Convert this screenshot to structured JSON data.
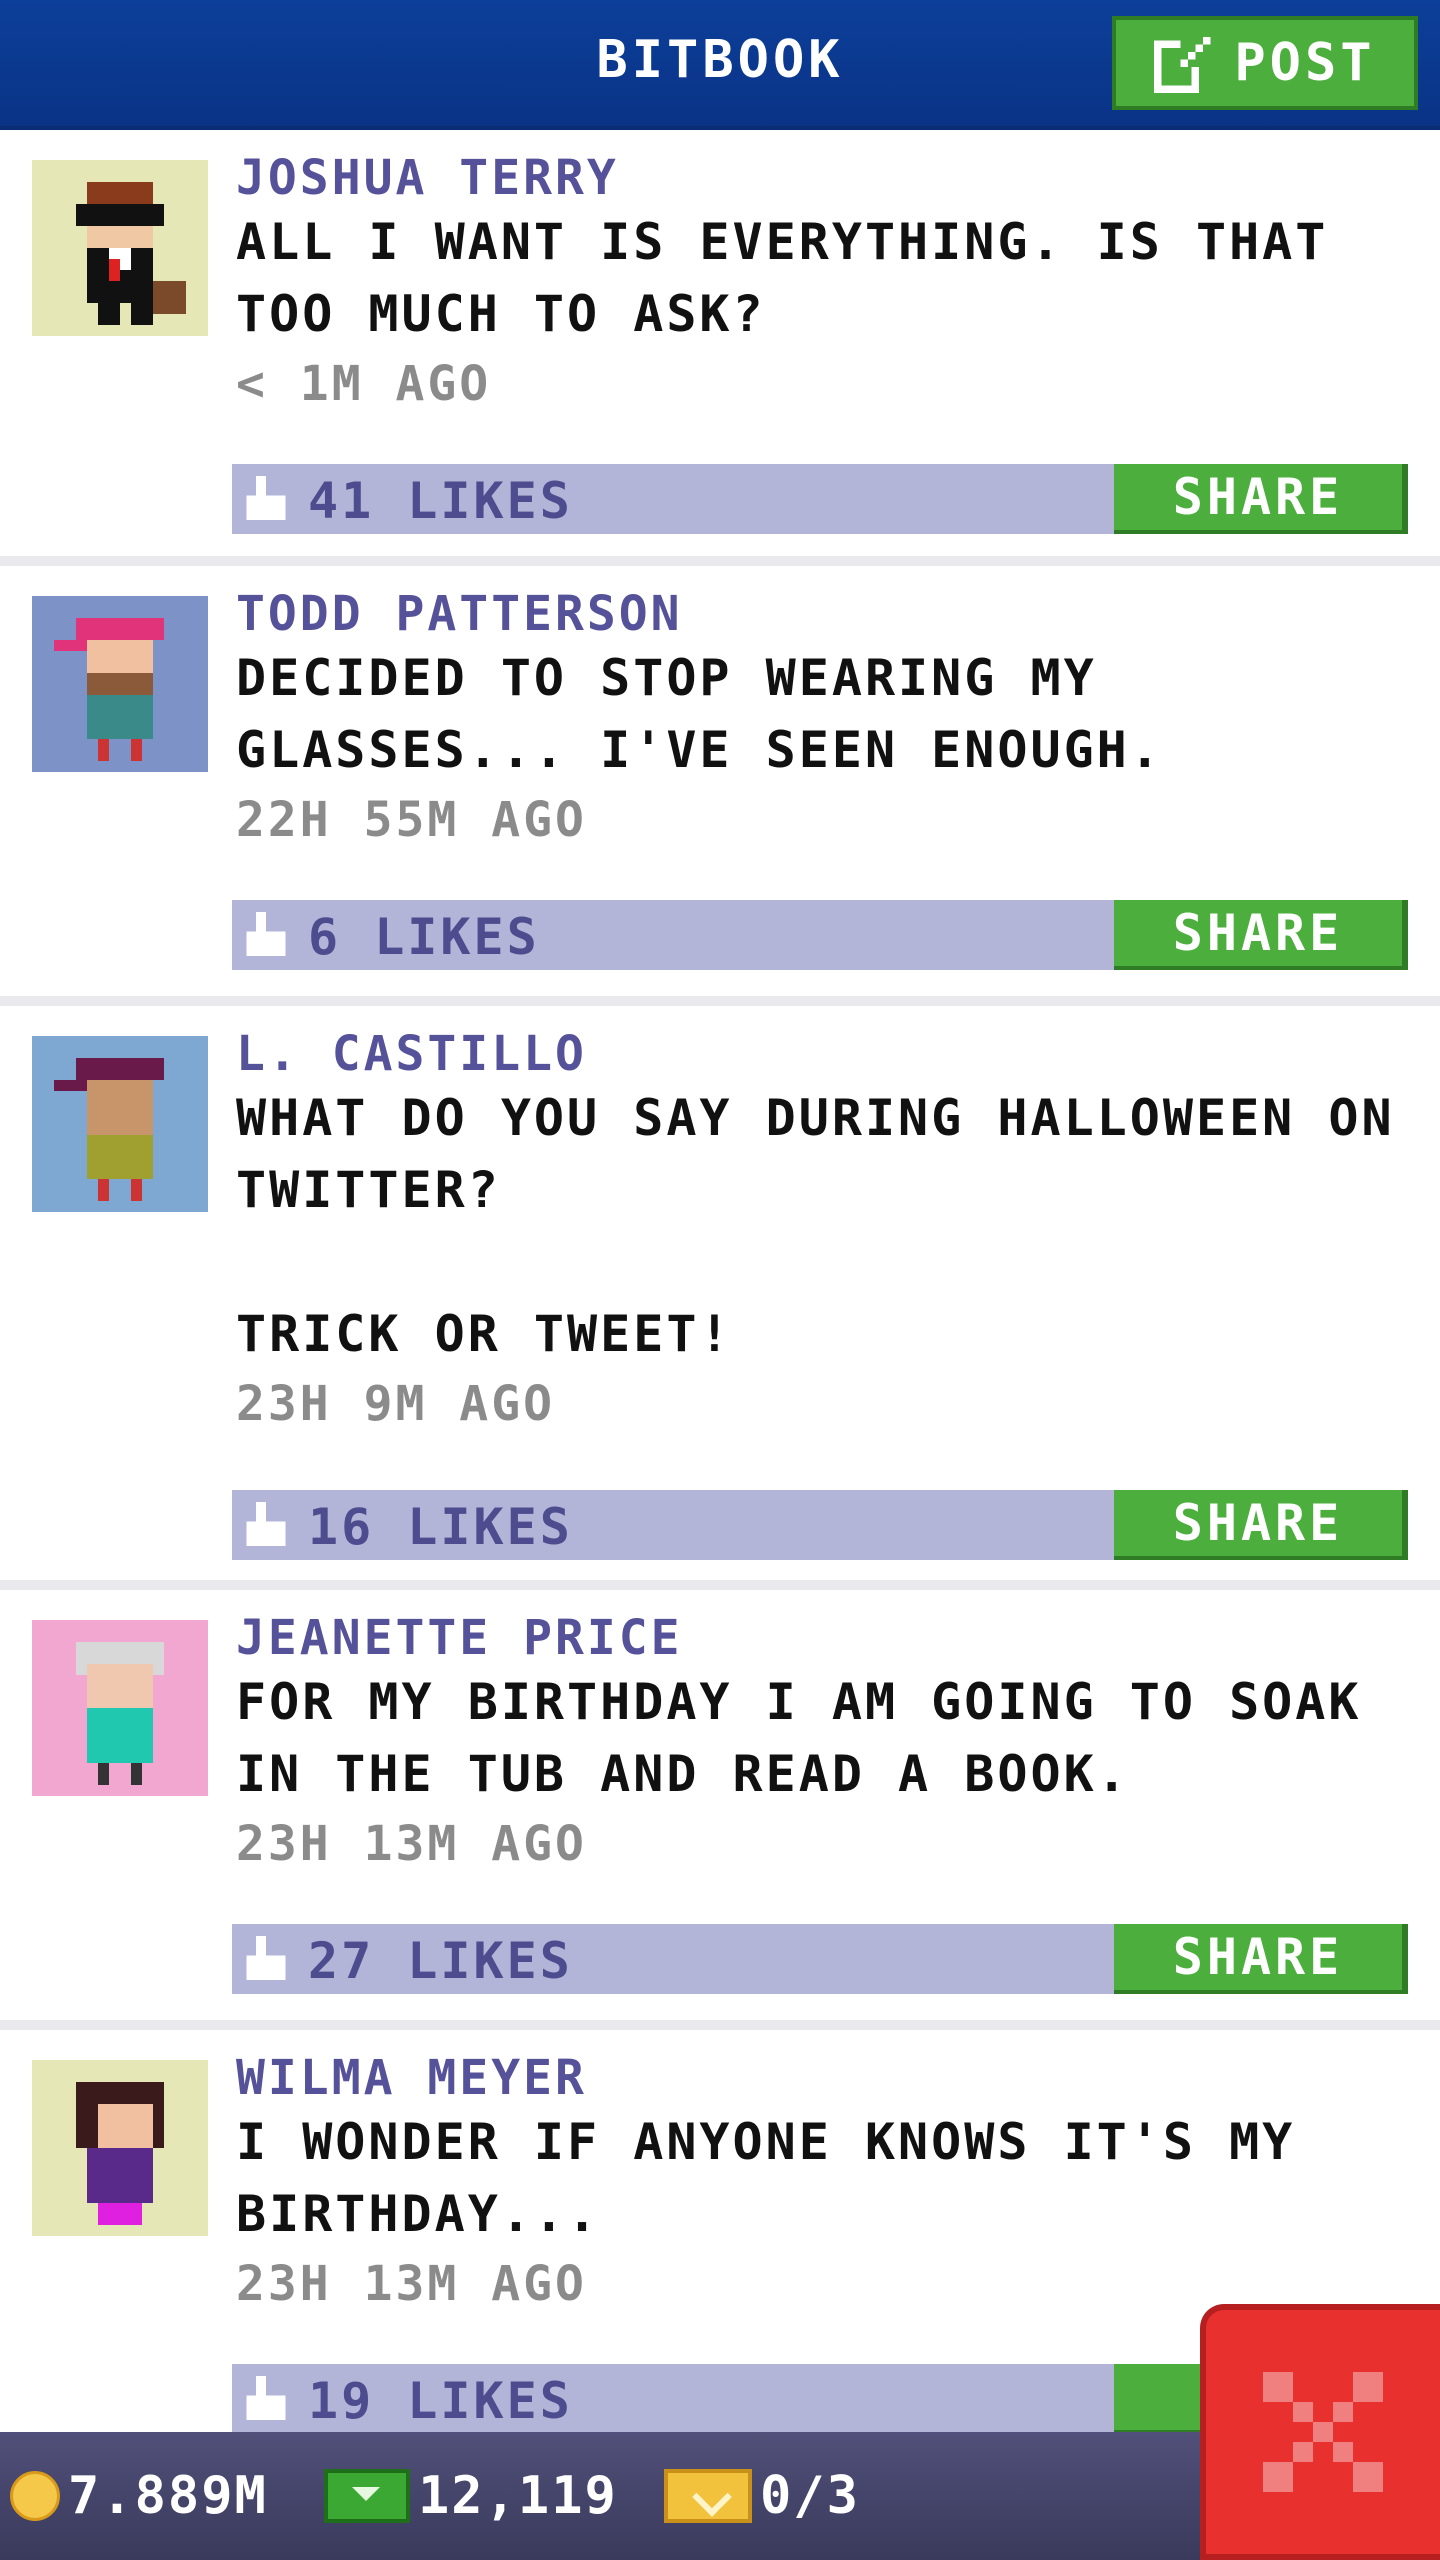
{
  "header": {
    "title": "BITBOOK",
    "post_label": "POST"
  },
  "posts": [
    {
      "author": "JOSHUA TERRY",
      "message": "ALL I WANT IS EVERYTHING. IS THAT TOO MUCH TO ASK?",
      "time": "< 1M AGO",
      "likes": "41 LIKES",
      "share": "SHARE",
      "avatar_bg": "#e6e7b7"
    },
    {
      "author": "TODD PATTERSON",
      "message": "DECIDED TO STOP WEARING MY GLASSES... I'VE SEEN ENOUGH.",
      "time": "22H 55M AGO",
      "likes": "6 LIKES",
      "share": "SHARE",
      "avatar_bg": "#7d92c6"
    },
    {
      "author": "L. CASTILLO",
      "message": "WHAT DO YOU SAY DURING HALLOWEEN ON TWITTER?\n\nTRICK OR TWEET!",
      "time": "23H 9M AGO",
      "likes": "16 LIKES",
      "share": "SHARE",
      "avatar_bg": "#7ea8d1"
    },
    {
      "author": "JEANETTE PRICE",
      "message": "FOR MY BIRTHDAY I AM GOING TO SOAK IN THE TUB AND READ A BOOK.",
      "time": "23H 13M AGO",
      "likes": "27 LIKES",
      "share": "SHARE",
      "avatar_bg": "#f2a7d0"
    },
    {
      "author": "WILMA MEYER",
      "message": "I WONDER IF ANYONE KNOWS IT'S MY BIRTHDAY...",
      "time": "23H 13M AGO",
      "likes": "19 LIKES",
      "share": "S",
      "avatar_bg": "#e6e7b7"
    }
  ],
  "status": {
    "coins": "7.889M",
    "cash": "12,119",
    "tickets": "0/3"
  },
  "colors": {
    "header_blue": "#0c3f9a",
    "accent_green": "#4cae3c",
    "likes_bar": "#b3b5d8",
    "author_purple": "#55529a",
    "close_red": "#e8302e"
  },
  "icons": {
    "post": "edit-icon",
    "like": "thumbs-up-icon",
    "coin": "coin-icon",
    "cash": "cash-icon",
    "ticket": "ticket-icon",
    "close": "close-icon"
  }
}
